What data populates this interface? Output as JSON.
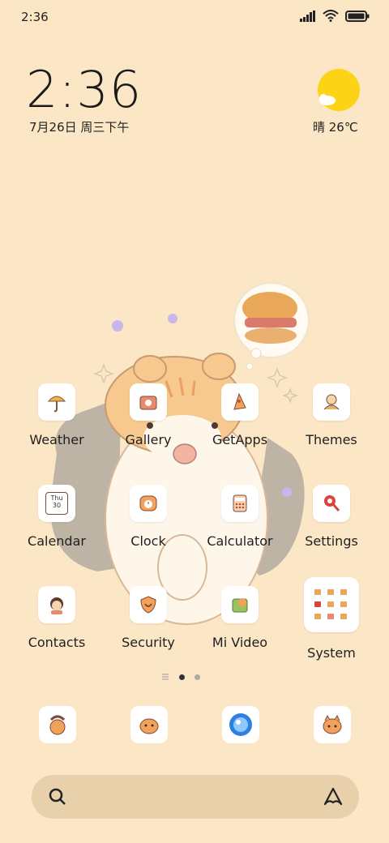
{
  "status_bar": {
    "time": "2:36"
  },
  "widget": {
    "clock": "2:36",
    "date": "7月26日 周三下午",
    "weather": "晴 26℃"
  },
  "apps": [
    {
      "label": "Weather",
      "icon": "weather-icon"
    },
    {
      "label": "Gallery",
      "icon": "gallery-icon"
    },
    {
      "label": "GetApps",
      "icon": "getapps-icon"
    },
    {
      "label": "Themes",
      "icon": "themes-icon"
    },
    {
      "label": "Calendar",
      "icon": "calendar-icon",
      "icon_text": "Thu 30"
    },
    {
      "label": "Clock",
      "icon": "clock-icon"
    },
    {
      "label": "Calculator",
      "icon": "calculator-icon"
    },
    {
      "label": "Settings",
      "icon": "settings-icon"
    },
    {
      "label": "Contacts",
      "icon": "contacts-icon"
    },
    {
      "label": "Security",
      "icon": "security-icon"
    },
    {
      "label": "Mi Video",
      "icon": "mi-video-icon"
    },
    {
      "label": "System",
      "icon": "system-folder-icon"
    }
  ],
  "dock": [
    "phone-icon",
    "messages-icon",
    "browser-icon",
    "camera-icon"
  ],
  "page_indicator": {
    "pages": 2,
    "current": 1
  },
  "search_bar": {
    "icon": "search-icon",
    "assistant_icon": "assistant-icon"
  },
  "colors": {
    "background": "#fbe6c5",
    "search_bar": "#e7d0aa",
    "sun": "#fcd316"
  }
}
